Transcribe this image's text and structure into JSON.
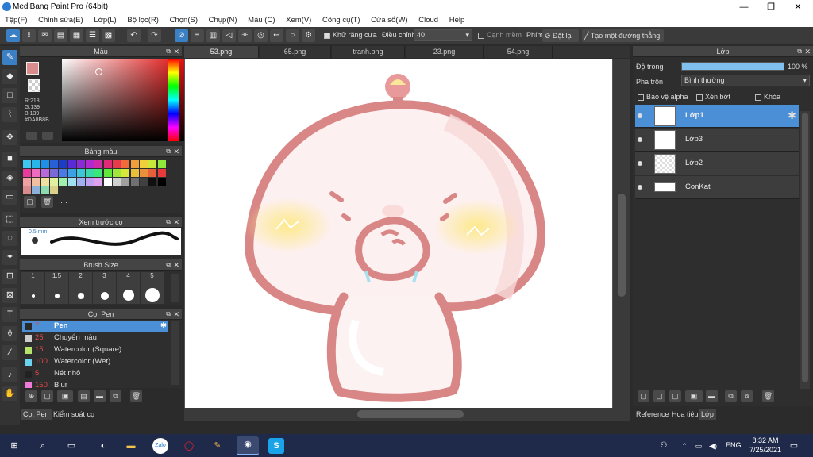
{
  "window": {
    "title": "MediBang Paint Pro (64bit)",
    "minimize": "—",
    "maximize": "❐",
    "close": "✕"
  },
  "menu": [
    "Tệp(F)",
    "Chỉnh sửa(E)",
    "Lớp(L)",
    "Bộ lọc(R)",
    "Chọn(S)",
    "Chụp(N)",
    "Màu (C)",
    "Xem(V)",
    "Công cụ(T)",
    "Cửa sổ(W)",
    "Cloud",
    "Help"
  ],
  "toolbar": {
    "antialias_label": "Khử răng cưa",
    "adjust_label": "Điều chỉnh",
    "adjust_value": "40",
    "soft_edge_label": "Cạnh mềm",
    "key_label": "Phím",
    "reset_label": "Đặt lại",
    "straight_line_label": "Tạo một đường thẳng"
  },
  "color_panel": {
    "title": "Màu",
    "readout": [
      "R:218",
      "G:139",
      "B:139",
      "#DA8B8B"
    ],
    "primary_color": "#da8b8b"
  },
  "palette_panel": {
    "title": "Bảng màu",
    "more": "···"
  },
  "preview_panel": {
    "title": "Xem trước cọ",
    "size_label": "0.5 mm"
  },
  "brush_size_panel": {
    "title": "Brush Size",
    "sizes": [
      "1",
      "1.5",
      "2",
      "3",
      "4",
      "5"
    ]
  },
  "brush_panel": {
    "title": "Cọ: Pen",
    "items": [
      {
        "num": "7",
        "name": "Pen",
        "color": "#2a2a2a"
      },
      {
        "num": "25",
        "name": "Chuyển màu",
        "color": "#cccccc"
      },
      {
        "num": "15",
        "name": "Watercolor (Square)",
        "color": "#b6e36a"
      },
      {
        "num": "100",
        "name": "Watercolor (Wet)",
        "color": "#6ad3f0"
      },
      {
        "num": "5",
        "name": "Nét nhỏ",
        "color": "#222222"
      },
      {
        "num": "150",
        "name": "Blur",
        "color": "#f07ad9"
      }
    ]
  },
  "left_bottom_tabs": [
    "Cọ: Pen",
    "Kiểm soát cọ"
  ],
  "doc_tabs": [
    "53.png",
    "65.png",
    "tranh.png",
    "23.png",
    "54.png"
  ],
  "layer_panel": {
    "title": "Lớp",
    "opacity_label": "Độ trong",
    "opacity_value": "100 %",
    "opacity_fraction": 1.0,
    "blend_label": "Pha trộn",
    "blend_value": "Bình thường",
    "protect_alpha": "Bảo vệ alpha",
    "clipping": "Xén bớt",
    "lock": "Khóa",
    "layers": [
      "Lớp1",
      "Lớp3",
      "Lớp2",
      "ConKat"
    ]
  },
  "right_bottom_tabs": [
    "Reference",
    "Hoa tiêu",
    "Lớp"
  ],
  "taskbar": {
    "lang": "ENG",
    "time": "8:32 AM",
    "date": "7/25/2021"
  }
}
